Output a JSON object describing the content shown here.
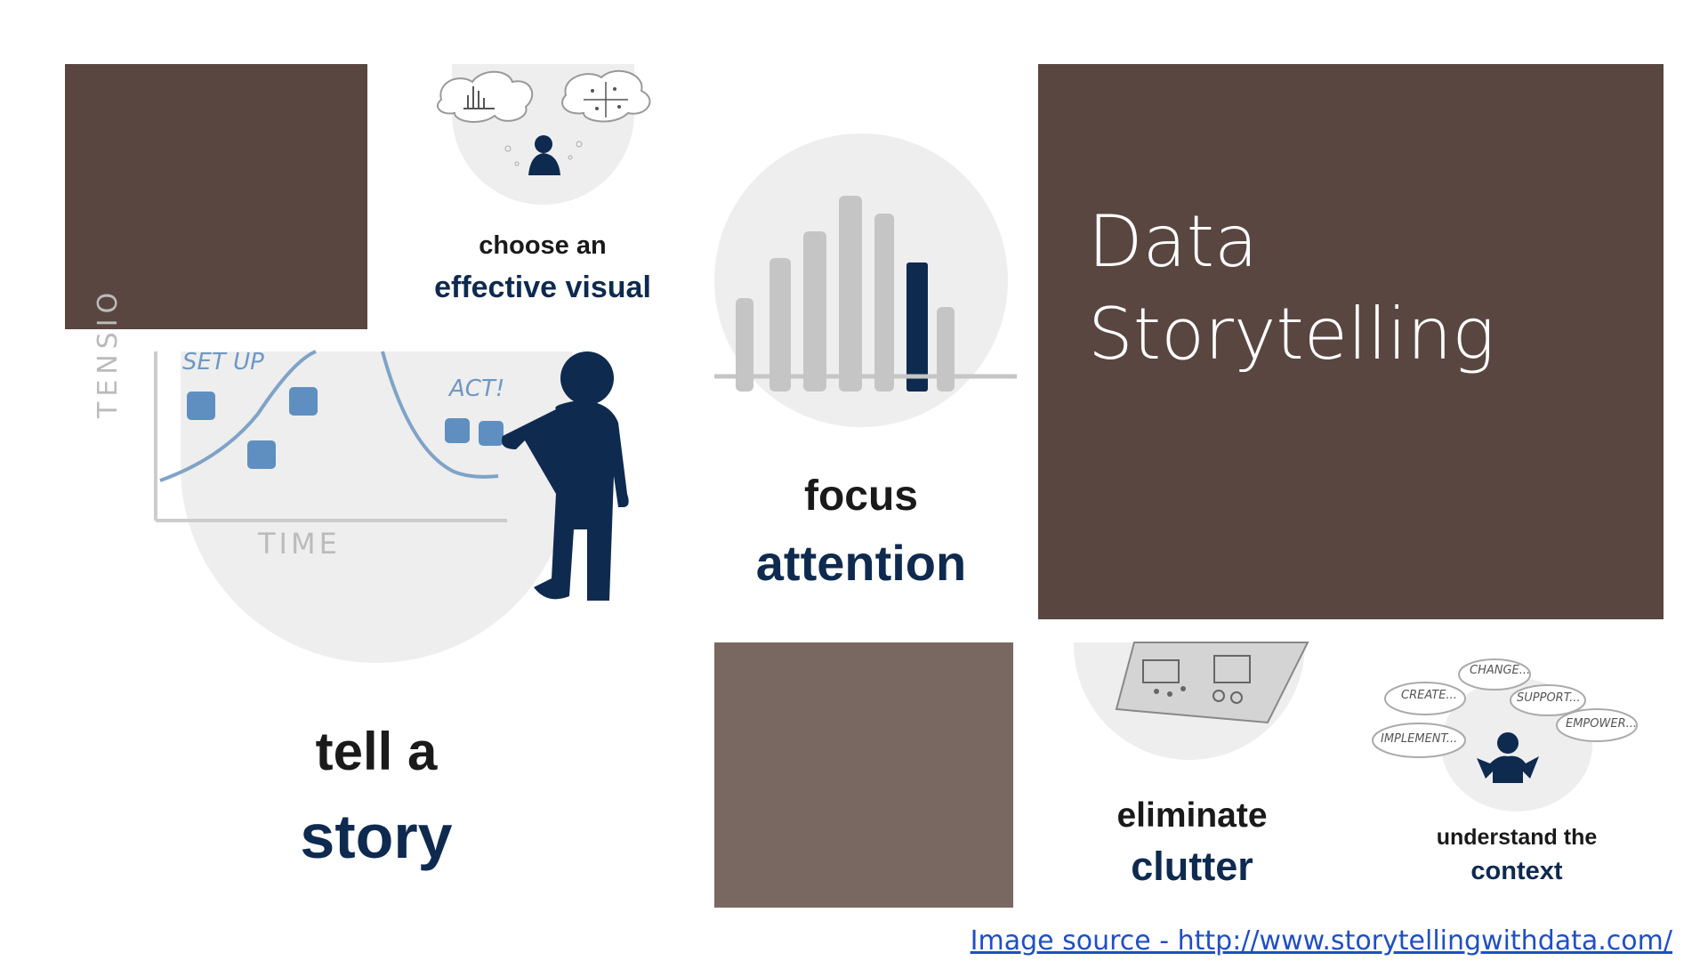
{
  "slide": {
    "title_line1": "Data",
    "title_line2": "Storytelling",
    "source_link": "Image source - http://www.storytellingwithdata.com/"
  },
  "panels": {
    "choose": {
      "line1": "choose an",
      "line2": "effective visual"
    },
    "focus": {
      "line1": "focus",
      "line2": "attention"
    },
    "tell": {
      "line1": "tell a",
      "line2": "story",
      "axis_y": "TENSIO",
      "axis_x": "TIME",
      "label_setup": "SET UP",
      "label_act": "ACT!"
    },
    "eliminate": {
      "line1": "eliminate",
      "line2": "clutter"
    },
    "context": {
      "line1": "understand the",
      "line2": "context",
      "bubbles": [
        "CHANGE...",
        "CREATE...",
        "SUPPORT...",
        "IMPLEMENT...",
        "EMPOWER..."
      ]
    }
  },
  "colors": {
    "brown_dark": "#594640",
    "brown_mid": "#796861",
    "navy": "#0f2a4f",
    "link": "#1f4fc2"
  }
}
